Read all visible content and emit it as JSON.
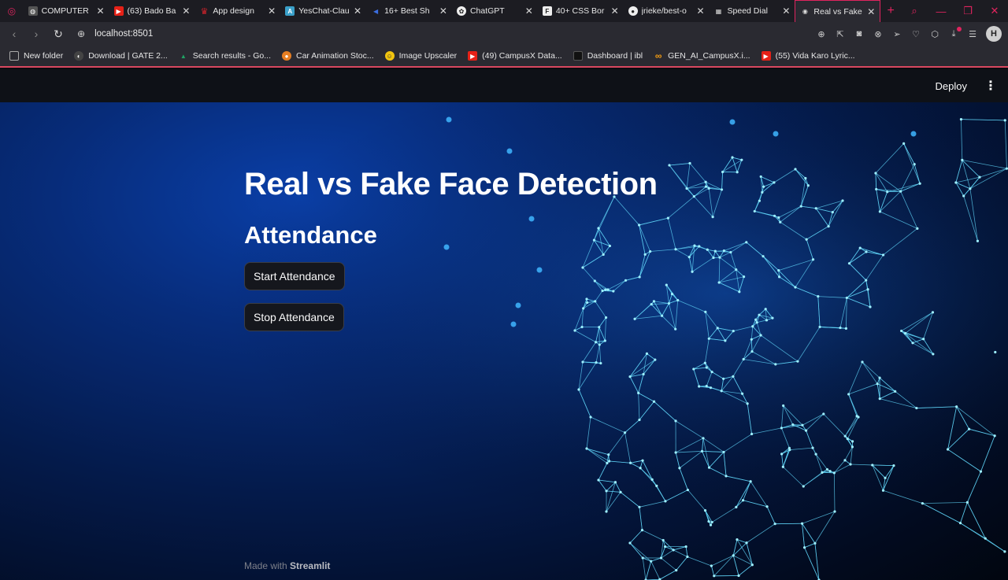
{
  "tabs": [
    {
      "title": "COMPUTER",
      "icon": "globe-icon",
      "color": "#555"
    },
    {
      "title": "(63) Bado Ba",
      "icon": "youtube-icon",
      "color": "#e62117"
    },
    {
      "title": "App design",
      "icon": "crown-icon",
      "color": "#d6232b"
    },
    {
      "title": "YesChat-Clau",
      "icon": "ai-icon",
      "color": "#3aa0c9"
    },
    {
      "title": "16+ Best Sh",
      "icon": "arrow-icon",
      "color": "#3b6ee0"
    },
    {
      "title": "ChatGPT",
      "icon": "chatgpt-icon",
      "color": "#444"
    },
    {
      "title": "40+ CSS Bor",
      "icon": "f-icon",
      "color": "#333"
    },
    {
      "title": "jrieke/best-o",
      "icon": "github-icon",
      "color": "#222"
    },
    {
      "title": "Speed Dial",
      "icon": "grid-icon",
      "color": "#444"
    },
    {
      "title": "Real vs Fake",
      "icon": "streamlit-icon",
      "color": "#2a2a31",
      "active": true
    }
  ],
  "address": {
    "url": "localhost:8501"
  },
  "bookmarks": [
    {
      "label": "New folder",
      "icon": "folder-icon",
      "color": "transparent"
    },
    {
      "label": "Download | GATE 2...",
      "icon": "moon-icon",
      "color": "#444"
    },
    {
      "label": "Search results - Go...",
      "icon": "drive-icon",
      "color": "#1fa463"
    },
    {
      "label": "Car Animation Stoc...",
      "icon": "circle-icon",
      "color": "#e67e22"
    },
    {
      "label": "Image Upscaler",
      "icon": "smile-icon",
      "color": "#f1c40f"
    },
    {
      "label": "(49) CampusX Data...",
      "icon": "youtube-icon",
      "color": "#e62117"
    },
    {
      "label": "Dashboard | ibl",
      "icon": "file-icon",
      "color": "#111"
    },
    {
      "label": "GEN_AI_CampusX.i...",
      "icon": "infinity-icon",
      "color": "#f39c12"
    },
    {
      "label": "(55) Vida Karo Lyric...",
      "icon": "youtube-icon",
      "color": "#e62117"
    }
  ],
  "header": {
    "deploy_label": "Deploy",
    "menu_glyph": "⋮"
  },
  "main": {
    "title": "Real vs Fake Face Detection",
    "subtitle": "Attendance",
    "start_button": "Start Attendance",
    "stop_button": "Stop Attendance"
  },
  "footer": {
    "prefix": "Made with",
    "brand": "Streamlit"
  },
  "profile": {
    "initial": "H"
  }
}
